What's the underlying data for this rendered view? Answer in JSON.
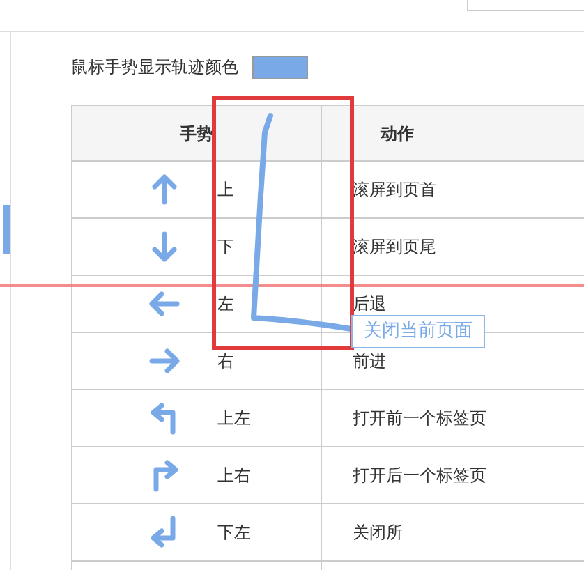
{
  "trail_color": {
    "label": "鼠标手势显示轨迹颜色",
    "color": "#7aa9e8"
  },
  "table": {
    "columns": [
      "手势",
      "动作"
    ],
    "rows": [
      {
        "gesture": "上",
        "action": "滚屏到页首"
      },
      {
        "gesture": "下",
        "action": "滚屏到页尾"
      },
      {
        "gesture": "左",
        "action": "后退"
      },
      {
        "gesture": "右",
        "action": "前进"
      },
      {
        "gesture": "上左",
        "action": "打开前一个标签页"
      },
      {
        "gesture": "上右",
        "action": "打开后一个标签页"
      },
      {
        "gesture": "下左",
        "action": "关闭所"
      }
    ]
  },
  "tooltip": "关闭当前页面"
}
